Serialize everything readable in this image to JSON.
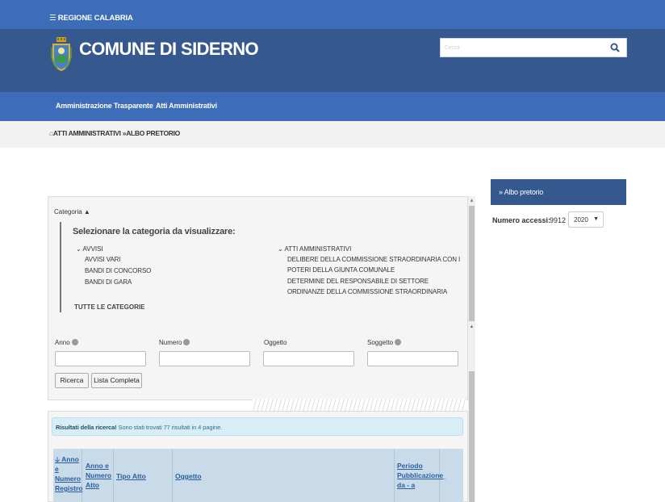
{
  "topbar": {
    "region_link": "☰ REGIONE CALABRIA"
  },
  "header": {
    "site_title": "COMUNE DI SIDERNO",
    "search": {
      "placeholder": "Cerca",
      "value": ""
    }
  },
  "navbar": {
    "items": [
      {
        "label": "Amministrazione Trasparente"
      },
      {
        "label": "Atti Amministrativi"
      }
    ]
  },
  "breadcrumb": {
    "items": [
      "ATTI AMMINISTRATIVI",
      "»",
      "ALBO PRETORIO"
    ]
  },
  "filter": {
    "toggle_label": "Categoria",
    "heading": "Selezionare la categoria da visualizzare:",
    "groups": [
      {
        "title": "AVVISI",
        "items": [
          "AVVISI VARI",
          "BANDI DI CONCORSO",
          "BANDI DI GARA"
        ]
      },
      {
        "title": "ATTI AMMINISTRATIVI",
        "items": [
          "DELIBERE DELLA COMMISSIONE STRAORDINARIA CON I",
          "POTERI DELLA GIUNTA COMUNALE",
          "DETERMINE DEL RESPONSABILE DI SETTORE",
          "ORDINANZE DELLA COMMISSIONE STRAORDINARIA"
        ]
      }
    ],
    "all_categories": "TUTTE LE CATEGORIE",
    "fields": [
      {
        "label": "Anno",
        "value": ""
      },
      {
        "label": "Numero",
        "value": ""
      },
      {
        "label": "Oggetto",
        "value": ""
      },
      {
        "label": "Soggetto",
        "value": ""
      }
    ],
    "buttons": {
      "search": "Ricerca",
      "full_list": "Lista Completa"
    }
  },
  "results": {
    "bold_text": "Risultati della ricerca!",
    "text": "Sono stati trovati 77 risultati in 4 pagine.",
    "columns": [
      {
        "lines": [
          "Anno",
          "e",
          "Numero",
          "Registro"
        ]
      },
      {
        "lines": [
          "Anno e",
          "Numero",
          "Atto"
        ]
      },
      {
        "lines": [
          "Tipo Atto"
        ]
      },
      {
        "lines": [
          "Oggetto"
        ]
      },
      {
        "lines": [
          "Periodo",
          "Pubblicazione",
          "da - a"
        ]
      },
      {
        "lines": [
          "_"
        ]
      }
    ]
  },
  "sidebar": {
    "title": "Albo pretorio",
    "access_label": "Numero accessi:",
    "access_count": "9912",
    "year_selected": "2020"
  },
  "colors": {
    "header_blue": "#35598f",
    "bar_blue": "#3d6cb9",
    "link_blue": "#2a5d9f",
    "alert_bg": "#d9edf7"
  }
}
